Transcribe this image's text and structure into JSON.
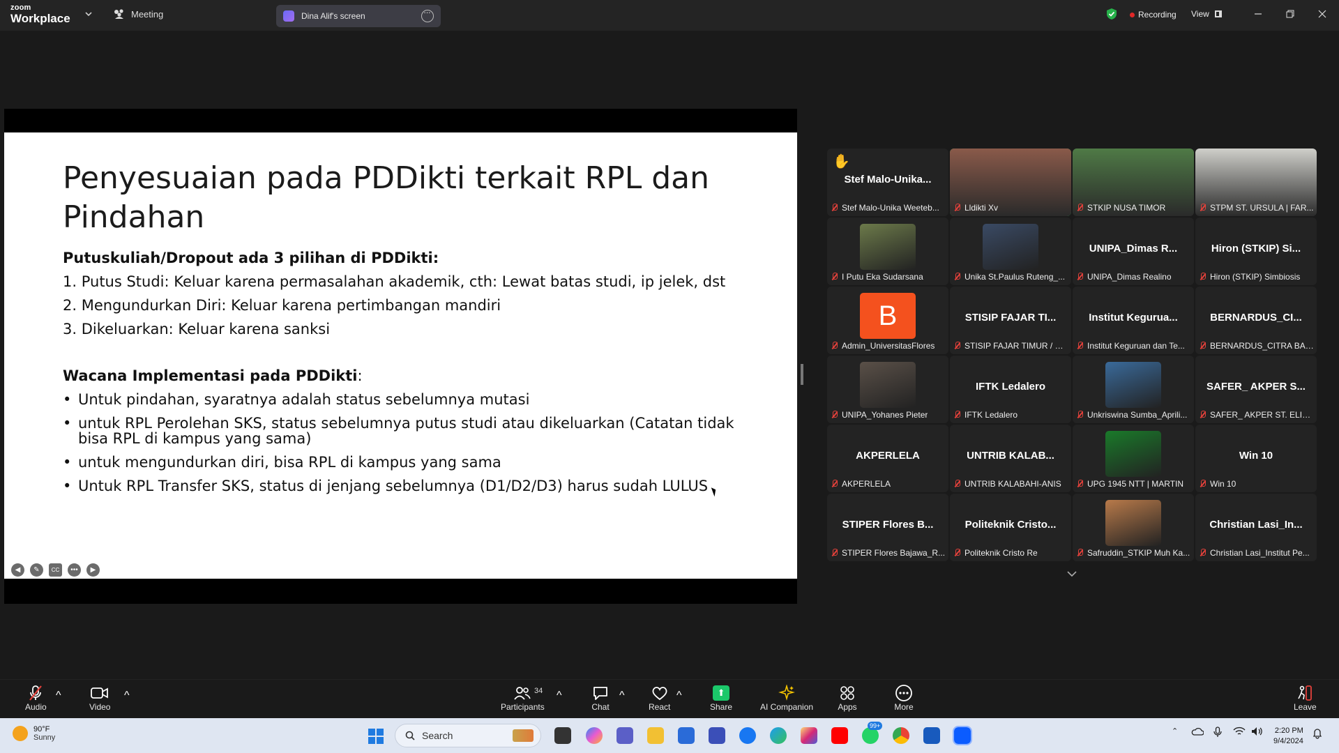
{
  "app": {
    "brand_line1": "zoom",
    "brand_line2": "Workplace",
    "meeting_label": "Meeting"
  },
  "screen_tab": {
    "label": "Dina Alif's screen"
  },
  "status": {
    "recording_label": "Recording",
    "view_label": "View"
  },
  "slide": {
    "title": "Penyesuaian pada PDDikti terkait RPL dan Pindahan",
    "section1_heading": "Putuskuliah/Dropout ada 3 pilihan di PDDikti:",
    "section1_items": [
      "1. Putus Studi: Keluar karena permasalahan akademik, cth: Lewat batas studi, ip jelek, dst",
      "2. Mengundurkan Diri: Keluar karena pertimbangan mandiri",
      "3. Dikeluarkan: Keluar karena sanksi"
    ],
    "section2_heading": "Wacana Implementasi pada PDDikti",
    "section2_colon": ":",
    "section2_items": [
      "Untuk pindahan, syaratnya adalah status sebelumnya mutasi",
      "untuk RPL Perolehan SKS, status sebelumnya putus studi atau dikeluarkan (Catatan tidak bisa RPL di kampus yang sama)",
      "untuk mengundurkan diri, bisa RPL di kampus yang sama",
      "Untuk RPL Transfer SKS, status di jenjang sebelumnya (D1/D2/D3) harus sudah LULUS"
    ],
    "cc_label": "CC"
  },
  "gallery": {
    "tiles": [
      {
        "big": "Stef  Malo-Unika...",
        "caption": "Stef Malo-Unika Weeteb...",
        "kind": "name",
        "hand": true
      },
      {
        "big": "",
        "caption": "Lldikti Xv",
        "kind": "video",
        "active": true,
        "color": "#8a5a4a"
      },
      {
        "big": "",
        "caption": "STKIP NUSA TIMOR",
        "kind": "video",
        "color": "#4f7a46"
      },
      {
        "big": "",
        "caption": "STPM ST. URSULA | FAR...",
        "kind": "video",
        "color": "#cfcfca"
      },
      {
        "big": "",
        "caption": "I Putu Eka Sudarsana",
        "kind": "photo",
        "color": "#6c7a4a"
      },
      {
        "big": "",
        "caption": "Unika St.Paulus Ruteng_...",
        "kind": "photo",
        "color": "#3a4a64"
      },
      {
        "big": "UNIPA_Dimas R...",
        "caption": "UNIPA_Dimas Realino",
        "kind": "name"
      },
      {
        "big": "Hiron (STKIP) Si...",
        "caption": "Hiron (STKIP) Simbiosis",
        "kind": "name"
      },
      {
        "big": "",
        "caption": "Admin_UniversitasFlores",
        "kind": "letter",
        "letter": "B",
        "color": "#f4511e"
      },
      {
        "big": "STISIP FAJAR TI...",
        "caption": "STISIP FAJAR TIMUR / M...",
        "kind": "name"
      },
      {
        "big": "Institut  Kegurua...",
        "caption": "Institut Keguruan dan Te...",
        "kind": "name"
      },
      {
        "big": "BERNARDUS_CI...",
        "caption": "BERNARDUS_CITRA BAKTI",
        "kind": "name"
      },
      {
        "big": "",
        "caption": "UNIPA_Yohanes Pieter",
        "kind": "photo",
        "color": "#5a5048"
      },
      {
        "big": "IFTK Ledalero",
        "caption": "IFTK Ledalero",
        "kind": "name"
      },
      {
        "big": "",
        "caption": "Unkriswina Sumba_Aprili...",
        "kind": "photo",
        "color": "#3a6a9a"
      },
      {
        "big": "SAFER_ AKPER S...",
        "caption": "SAFER_ AKPER ST. ELISA...",
        "kind": "name"
      },
      {
        "big": "AKPERLELA",
        "caption": "AKPERLELA",
        "kind": "name"
      },
      {
        "big": "UNTRIB KALAB...",
        "caption": "UNTRIB KALABAHI-ANIS",
        "kind": "name"
      },
      {
        "big": "",
        "caption": "UPG 1945 NTT | MARTIN",
        "kind": "photo",
        "color": "#1a7a2a"
      },
      {
        "big": "Win 10",
        "caption": "Win 10",
        "kind": "name"
      },
      {
        "big": "STIPER Flores B...",
        "caption": "STIPER Flores Bajawa_R...",
        "kind": "name"
      },
      {
        "big": "Politeknik  Cristo...",
        "caption": "Politeknik Cristo Re",
        "kind": "name"
      },
      {
        "big": "",
        "caption": "Safruddin_STKIP Muh Ka...",
        "kind": "photo",
        "color": "#b87a4a"
      },
      {
        "big": "Christian  Lasi_In...",
        "caption": "Christian Lasi_Institut Pe...",
        "kind": "name"
      }
    ]
  },
  "toolbar": {
    "audio": "Audio",
    "video": "Video",
    "participants": "Participants",
    "participants_count": "34",
    "chat": "Chat",
    "react": "React",
    "share": "Share",
    "ai": "AI Companion",
    "apps": "Apps",
    "more": "More",
    "leave": "Leave"
  },
  "taskbar": {
    "temp": "90°F",
    "weather": "Sunny",
    "search_placeholder": "Search",
    "badge": "99+",
    "time": "2:20 PM",
    "date": "9/4/2024"
  },
  "colors": {
    "accent_green": "#2dcc5b",
    "mute_red": "#e5413b",
    "share_green": "#1bc86a",
    "rec_red": "#e02828"
  }
}
